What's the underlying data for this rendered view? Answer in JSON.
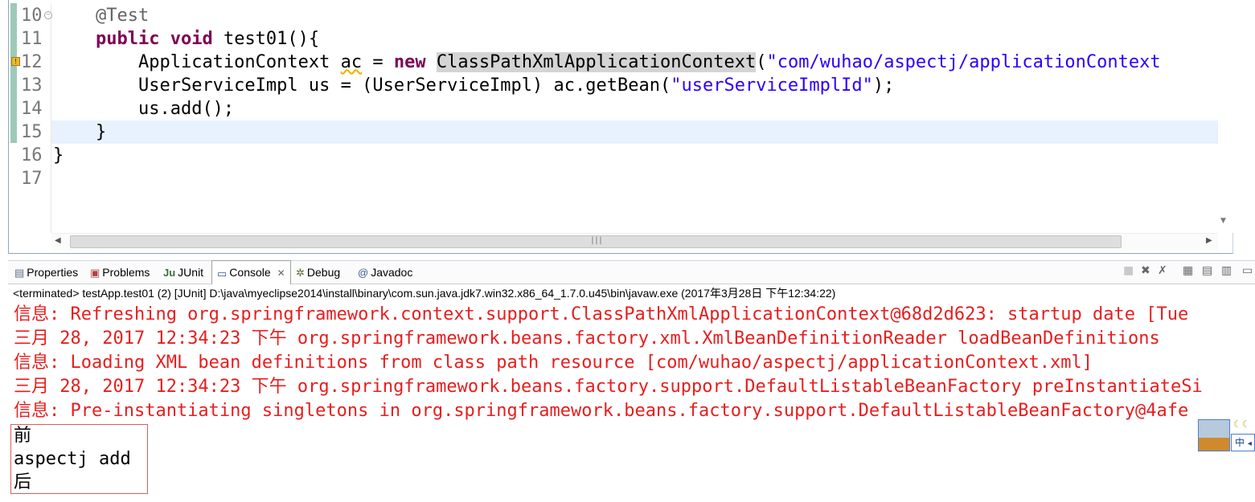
{
  "editor": {
    "line_numbers": [
      "10",
      "11",
      "12",
      "13",
      "14",
      "15",
      "16",
      "17"
    ],
    "lines": [
      {
        "annotation": "@Test"
      },
      {
        "kw1": "public",
        "kw2": "void",
        "text": " test01(){"
      },
      {
        "type": "ApplicationContext ",
        "var": "ac",
        "eq": " = ",
        "kw": "new",
        "cls": "ClassPathXmlApplicationContext",
        "paren": "(",
        "str": "\"com/wuhao/aspectj/applicationContext"
      },
      {
        "pre": "UserServiceImpl us = (UserServiceImpl) ac.getBean(",
        "str": "\"userServiceImplId\"",
        "post": ");"
      },
      {
        "text": "us.add();"
      },
      {
        "text": "}"
      },
      {
        "text": "}"
      },
      {
        "text": ""
      }
    ]
  },
  "panel": {
    "tabs": [
      "Properties",
      "Problems",
      "JUnit",
      "Console",
      "Debug",
      "Javadoc"
    ],
    "active_tab": "Console",
    "status": "<terminated> testApp.test01 (2) [JUnit] D:\\java\\myeclipse2014\\install\\binary\\com.sun.java.jdk7.win32.x86_64_1.7.0.u45\\bin\\javaw.exe (2017年3月28日 下午12:34:22)",
    "console_err": [
      "信息: Refreshing org.springframework.context.support.ClassPathXmlApplicationContext@68d2d623: startup date [Tue",
      "三月 28, 2017 12:34:23 下午 org.springframework.beans.factory.xml.XmlBeanDefinitionReader loadBeanDefinitions",
      "信息: Loading XML bean definitions from class path resource [com/wuhao/aspectj/applicationContext.xml]",
      "三月 28, 2017 12:34:23 下午 org.springframework.beans.factory.support.DefaultListableBeanFactory preInstantiateSi",
      "信息: Pre-instantiating singletons in org.springframework.beans.factory.support.DefaultListableBeanFactory@4afe"
    ],
    "console_out": [
      "前",
      "aspectj add",
      "后"
    ]
  },
  "ime": {
    "label": "中",
    "arrow": "◂"
  },
  "icons": [
    "properties-icon",
    "problems-icon",
    "junit-icon",
    "console-icon",
    "debug-icon",
    "javadoc-icon",
    "terminate-icon",
    "remove-launch-icon",
    "remove-all-icon",
    "scroll-lock-icon",
    "pin-icon",
    "display-console-icon",
    "minimize-icon",
    "maximize-icon"
  ],
  "colors": {
    "keyword": "#7f0055",
    "string": "#2a00ff",
    "annotation": "#646464",
    "console_err": "#e61e1e",
    "current_line": "#e8f2fe"
  }
}
